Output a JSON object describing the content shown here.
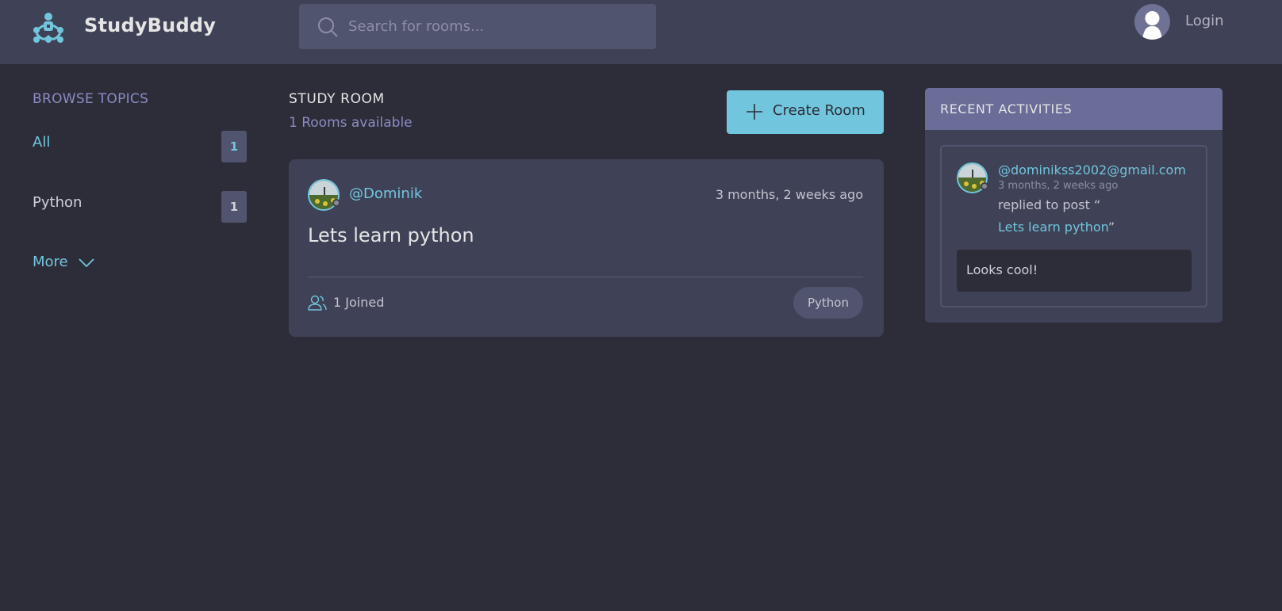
{
  "header": {
    "brand": "StudyBuddy",
    "search_placeholder": "Search for rooms...",
    "login_label": "Login",
    "icons": {
      "logo": "studybuddy-logo-icon",
      "search": "search-icon",
      "user": "user-avatar-icon"
    }
  },
  "sidebar": {
    "title": "BROWSE TOPICS",
    "topics": [
      {
        "label": "All",
        "count": "1"
      },
      {
        "label": "Python",
        "count": "1"
      }
    ],
    "more_label": "More"
  },
  "main": {
    "heading": "STUDY ROOM",
    "rooms_available": "1 Rooms available",
    "create_label": "Create Room",
    "rooms": [
      {
        "host": "@Dominik",
        "time": "3 months, 2 weeks ago",
        "title": "Lets learn python",
        "joined": "1 Joined",
        "topic": "Python"
      }
    ]
  },
  "activities": {
    "title": "RECENT ACTIVITIES",
    "items": [
      {
        "user": "@dominikss2002@gmail.com",
        "time": "3 months, 2 weeks ago",
        "action": "replied to post “",
        "post": "Lets learn python",
        "post_suffix": "”",
        "message": "Looks cool!"
      }
    ]
  },
  "colors": {
    "background": "#2d2d39",
    "header": "#3f4156",
    "accent": "#71c6dd",
    "muted_purple": "#8a8bc4",
    "activity_header": "#696d97"
  }
}
